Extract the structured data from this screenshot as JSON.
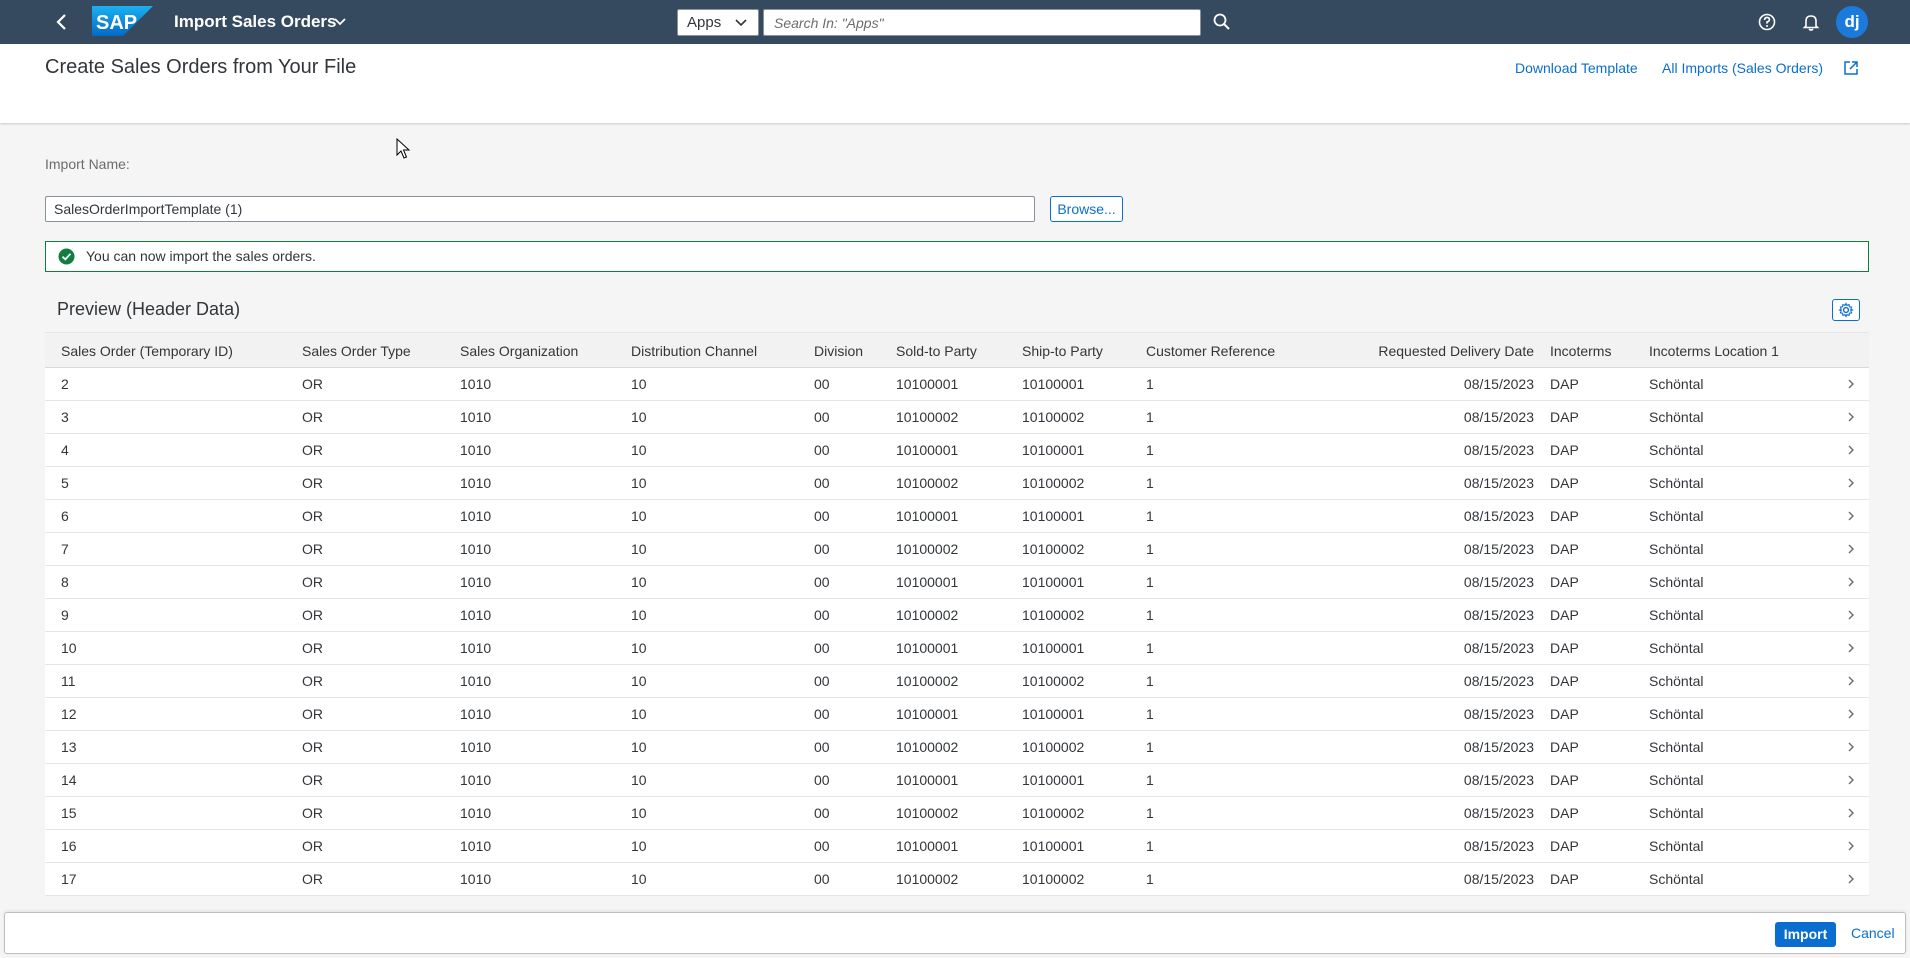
{
  "shell": {
    "app_title": "Import Sales Orders",
    "scope_select": "Apps",
    "search_placeholder": "Search In: \"Apps\"",
    "avatar_initials": "dj",
    "logo_text": "SAP"
  },
  "page": {
    "title": "Create Sales Orders from Your File",
    "download_template": "Download Template",
    "all_imports": "All Imports (Sales Orders)"
  },
  "import": {
    "name_label": "Import Name:",
    "name_value": "SalesOrderImportTemplate (1)",
    "browse_label": "Browse...",
    "success_message": "You can now import the sales orders."
  },
  "preview": {
    "title": "Preview (Header Data)",
    "columns": [
      "Sales Order (Temporary ID)",
      "Sales Order Type",
      "Sales Organization",
      "Distribution Channel",
      "Division",
      "Sold-to Party",
      "Ship-to Party",
      "Customer Reference",
      "Requested Delivery Date",
      "Incoterms",
      "Incoterms Location 1"
    ],
    "rows": [
      [
        "2",
        "OR",
        "1010",
        "10",
        "00",
        "10100001",
        "10100001",
        "1",
        "08/15/2023",
        "DAP",
        "Schöntal"
      ],
      [
        "3",
        "OR",
        "1010",
        "10",
        "00",
        "10100002",
        "10100002",
        "1",
        "08/15/2023",
        "DAP",
        "Schöntal"
      ],
      [
        "4",
        "OR",
        "1010",
        "10",
        "00",
        "10100001",
        "10100001",
        "1",
        "08/15/2023",
        "DAP",
        "Schöntal"
      ],
      [
        "5",
        "OR",
        "1010",
        "10",
        "00",
        "10100002",
        "10100002",
        "1",
        "08/15/2023",
        "DAP",
        "Schöntal"
      ],
      [
        "6",
        "OR",
        "1010",
        "10",
        "00",
        "10100001",
        "10100001",
        "1",
        "08/15/2023",
        "DAP",
        "Schöntal"
      ],
      [
        "7",
        "OR",
        "1010",
        "10",
        "00",
        "10100002",
        "10100002",
        "1",
        "08/15/2023",
        "DAP",
        "Schöntal"
      ],
      [
        "8",
        "OR",
        "1010",
        "10",
        "00",
        "10100001",
        "10100001",
        "1",
        "08/15/2023",
        "DAP",
        "Schöntal"
      ],
      [
        "9",
        "OR",
        "1010",
        "10",
        "00",
        "10100002",
        "10100002",
        "1",
        "08/15/2023",
        "DAP",
        "Schöntal"
      ],
      [
        "10",
        "OR",
        "1010",
        "10",
        "00",
        "10100001",
        "10100001",
        "1",
        "08/15/2023",
        "DAP",
        "Schöntal"
      ],
      [
        "11",
        "OR",
        "1010",
        "10",
        "00",
        "10100002",
        "10100002",
        "1",
        "08/15/2023",
        "DAP",
        "Schöntal"
      ],
      [
        "12",
        "OR",
        "1010",
        "10",
        "00",
        "10100001",
        "10100001",
        "1",
        "08/15/2023",
        "DAP",
        "Schöntal"
      ],
      [
        "13",
        "OR",
        "1010",
        "10",
        "00",
        "10100002",
        "10100002",
        "1",
        "08/15/2023",
        "DAP",
        "Schöntal"
      ],
      [
        "14",
        "OR",
        "1010",
        "10",
        "00",
        "10100001",
        "10100001",
        "1",
        "08/15/2023",
        "DAP",
        "Schöntal"
      ],
      [
        "15",
        "OR",
        "1010",
        "10",
        "00",
        "10100002",
        "10100002",
        "1",
        "08/15/2023",
        "DAP",
        "Schöntal"
      ],
      [
        "16",
        "OR",
        "1010",
        "10",
        "00",
        "10100001",
        "10100001",
        "1",
        "08/15/2023",
        "DAP",
        "Schöntal"
      ],
      [
        "17",
        "OR",
        "1010",
        "10",
        "00",
        "10100002",
        "10100002",
        "1",
        "08/15/2023",
        "DAP",
        "Schöntal"
      ]
    ]
  },
  "footer": {
    "import_label": "Import",
    "cancel_label": "Cancel"
  },
  "colors": {
    "shell_bg": "#354a5f",
    "accent": "#0a6ed1",
    "success": "#107e3e"
  }
}
